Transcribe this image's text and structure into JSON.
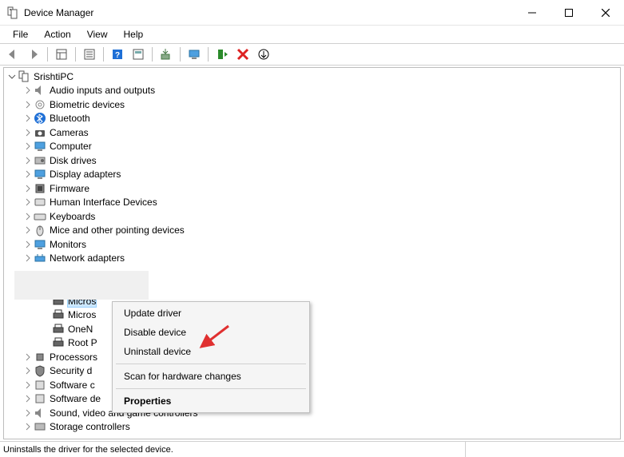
{
  "window": {
    "title": "Device Manager"
  },
  "menubar": {
    "file": "File",
    "action": "Action",
    "view": "View",
    "help": "Help"
  },
  "tree": {
    "root": "SrishtiPC",
    "items": [
      "Audio inputs and outputs",
      "Biometric devices",
      "Bluetooth",
      "Cameras",
      "Computer",
      "Disk drives",
      "Display adapters",
      "Firmware",
      "Human Interface Devices",
      "Keyboards",
      "Mice and other pointing devices",
      "Monitors",
      "Network adapters"
    ],
    "printers": {
      "sel": "Micros",
      "p2": "Micros",
      "p3": "OneN",
      "p4": "Root P"
    },
    "after": [
      "Processors",
      "Security d",
      "Software c",
      "Software de",
      "Sound, video and game controllers",
      "Storage controllers"
    ]
  },
  "context": {
    "update": "Update driver",
    "disable": "Disable device",
    "uninstall": "Uninstall device",
    "scan": "Scan for hardware changes",
    "properties": "Properties"
  },
  "status": {
    "text": "Uninstalls the driver for the selected device."
  }
}
